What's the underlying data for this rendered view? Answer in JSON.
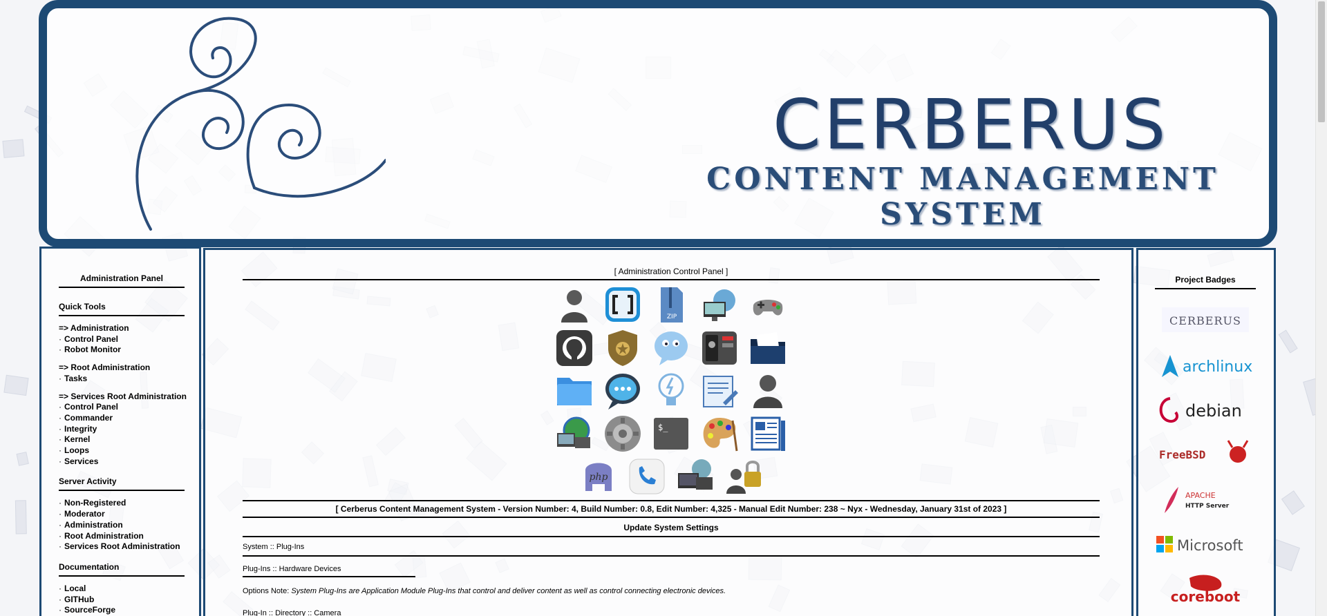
{
  "banner": {
    "title": "CERBERUS",
    "subtitle": "CONTENT MANAGEMENT SYSTEM"
  },
  "left_panel": {
    "title": "Administration Panel",
    "sections": [
      {
        "heading": "Quick Tools",
        "groups": [
          {
            "header": "=> Administration",
            "items": [
              "Control Panel",
              "Robot Monitor"
            ]
          },
          {
            "header": "=> Root Administration",
            "items": [
              "Tasks"
            ]
          },
          {
            "header": "=> Services Root Administration",
            "items": [
              "Control Panel",
              "Commander",
              "Integrity",
              "Kernel",
              "Loops",
              "Services"
            ]
          }
        ]
      },
      {
        "heading": "Server Activity",
        "items": [
          "Non-Registered",
          "Moderator",
          "Administration",
          "Root Administration",
          "Services Root Administration"
        ]
      },
      {
        "heading": "Documentation",
        "items": [
          "Local",
          "GITHub",
          "SourceForge"
        ]
      }
    ],
    "bullet": "·"
  },
  "main": {
    "title": "[ Administration Control Panel ]",
    "icons": [
      [
        "user-silhouette-icon",
        "brackets-icon",
        "zip-archive-icon",
        "network-monitor-icon",
        "gamepad-icon"
      ],
      [
        "github-icon",
        "security-badge-icon",
        "chat-face-icon",
        "power-panel-icon",
        "folder-documents-icon"
      ],
      [
        "folder-icon",
        "speech-bubble-icon",
        "lightbulb-icon",
        "text-editor-icon",
        "user-bust-icon"
      ],
      [
        "network-globe-icon",
        "gear-icon",
        "terminal-icon",
        "paint-palette-icon",
        "newspaper-icon"
      ],
      [
        "php-elephant-icon",
        "phone-icon",
        "monitors-globe-icon",
        "user-lock-icon"
      ]
    ],
    "version_line": "[ Cerberus Content Management System - Version Number: 4, Build Number: 0.8, Edit Number: 4,325 - Manual Edit Number: 238 ~ Nyx - Wednesday, January 31st of 2023 ]",
    "update_title": "Update System Settings",
    "crumb_plugins": "System :: Plug-Ins",
    "crumb_hardware": "Plug-Ins :: Hardware Devices",
    "note_label": "Options Note:",
    "note_text": "System Plug-Ins are Application Module Plug-Ins that control and deliver content as well as control connecting electronic devices.",
    "crumb_camera": "Plug-In :: Directory :: Camera"
  },
  "right_panel": {
    "title": "Project Badges",
    "badges": [
      {
        "name": "cerberus",
        "text": "CERBERUS"
      },
      {
        "name": "archlinux",
        "text": "archlinux"
      },
      {
        "name": "debian",
        "text": "debian"
      },
      {
        "name": "freebsd",
        "text": "FreeBSD"
      },
      {
        "name": "apache",
        "text": "APACHE",
        "sub": "HTTP Server"
      },
      {
        "name": "microsoft",
        "text": "Microsoft"
      },
      {
        "name": "coreboot",
        "text": "coreboot"
      }
    ]
  },
  "colors": {
    "frame": "#1d4a74",
    "brand_text": "#223f6a"
  }
}
